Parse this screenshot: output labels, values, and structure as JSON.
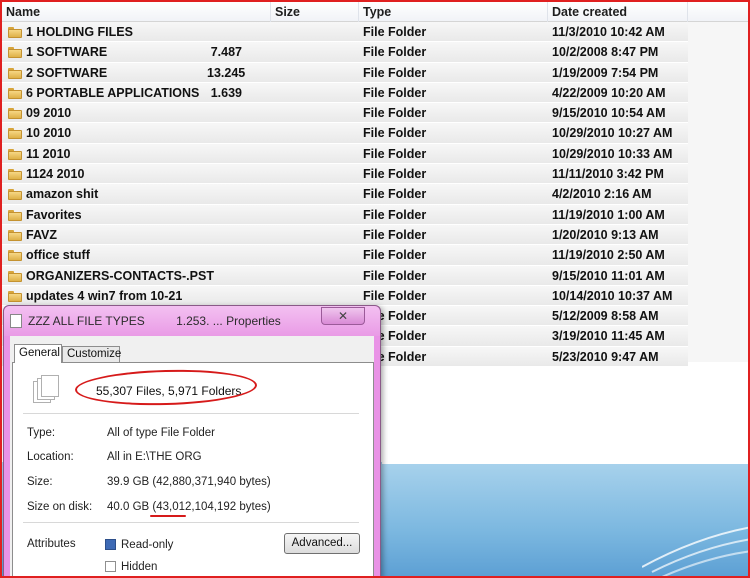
{
  "columns": {
    "name": "Name",
    "size": "Size",
    "type": "Type",
    "date": "Date created"
  },
  "rows": [
    {
      "name": "1 HOLDING FILES",
      "size": "",
      "type": "File Folder",
      "date": "11/3/2010 10:42 AM"
    },
    {
      "name": "1 SOFTWARE",
      "size": "7.487",
      "type": "File Folder",
      "date": "10/2/2008 8:47 PM"
    },
    {
      "name": "2 SOFTWARE",
      "size": "13.245",
      "type": "File Folder",
      "date": "1/19/2009 7:54 PM"
    },
    {
      "name": "6 PORTABLE APPLICATIONS",
      "size": "1.639",
      "type": "File Folder",
      "date": "4/22/2009 10:20 AM"
    },
    {
      "name": "09 2010",
      "size": "",
      "type": "File Folder",
      "date": "9/15/2010 10:54 AM"
    },
    {
      "name": "10 2010",
      "size": "",
      "type": "File Folder",
      "date": "10/29/2010 10:27 AM"
    },
    {
      "name": "11 2010",
      "size": "",
      "type": "File Folder",
      "date": "10/29/2010 10:33 AM"
    },
    {
      "name": "1124 2010",
      "size": "",
      "type": "File Folder",
      "date": "11/11/2010 3:42 PM"
    },
    {
      "name": "amazon shit",
      "size": "",
      "type": "File Folder",
      "date": "4/2/2010 2:16 AM"
    },
    {
      "name": "Favorites",
      "size": "",
      "type": "File Folder",
      "date": "11/19/2010 1:00 AM"
    },
    {
      "name": "FAVZ",
      "size": "",
      "type": "File Folder",
      "date": "1/20/2010 9:13 AM"
    },
    {
      "name": "office stuff",
      "size": "",
      "type": "File Folder",
      "date": "11/19/2010 2:50 AM"
    },
    {
      "name": "ORGANIZERS-CONTACTS-.PST",
      "size": "",
      "type": "File Folder",
      "date": "9/15/2010 11:01 AM"
    },
    {
      "name": "updates 4 win7 from 10-21",
      "size": "",
      "type": "File Folder",
      "date": "10/14/2010 10:37 AM"
    },
    {
      "name": "",
      "size": "",
      "type": "File Folder",
      "date": "5/12/2009 8:58 AM"
    },
    {
      "name": "",
      "size": "",
      "type": "File Folder",
      "date": "3/19/2010 11:45 AM"
    },
    {
      "name": "",
      "size": "",
      "type": "File Folder",
      "date": "5/23/2010 9:47 AM"
    }
  ],
  "dialog": {
    "title": "ZZZ ALL FILE TYPES",
    "title_suffix": "1.253. ... Properties",
    "close_label": "✕",
    "tabs": [
      "General",
      "Customize"
    ],
    "count": "55,307 Files, 5,971 Folders",
    "labels": {
      "type": "Type:",
      "location": "Location:",
      "size": "Size:",
      "size_on_disk": "Size on disk:",
      "attributes": "Attributes"
    },
    "values": {
      "type": "All of type File Folder",
      "location": "All in E:\\THE ORG",
      "size": "39.9 GB (42,880,371,940 bytes)",
      "size_on_disk": "40.0 GB (43,012,104,192 bytes)"
    },
    "attributes": {
      "read_only": "Read-only",
      "hidden": "Hidden",
      "read_only_checked": true
    },
    "advanced_label": "Advanced..."
  },
  "colors": {
    "annotation_red": "#d61a1a",
    "dialog_frame": "#e993e6",
    "frame_border": "#e02020"
  },
  "icons": {
    "folder": "folder-icon",
    "files": "multiple-files-icon",
    "close": "close-icon"
  }
}
